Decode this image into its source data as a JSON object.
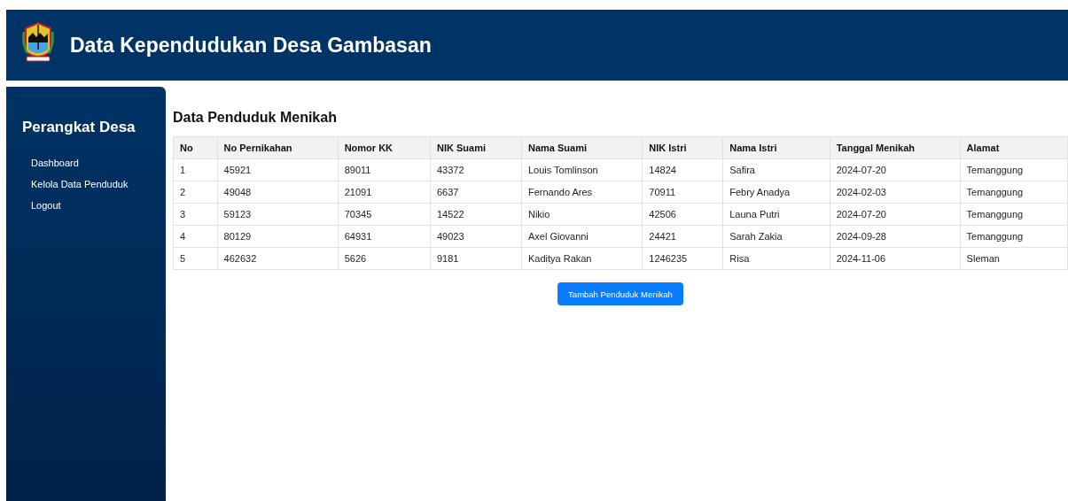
{
  "header": {
    "title": "Data Kependudukan Desa Gambasan"
  },
  "sidebar": {
    "title": "Perangkat Desa",
    "items": [
      {
        "label": "Dashboard"
      },
      {
        "label": "Kelola Data Penduduk"
      },
      {
        "label": "Logout"
      }
    ]
  },
  "main": {
    "title": "Data Penduduk Menikah",
    "table": {
      "columns": [
        "No",
        "No Pernikahan",
        "Nomor KK",
        "NIK Suami",
        "Nama Suami",
        "NIK Istri",
        "Nama Istri",
        "Tanggal Menikah",
        "Alamat"
      ],
      "rows": [
        [
          "1",
          "45921",
          "89011",
          "43372",
          "Louis Tomlinson",
          "14824",
          "Safira",
          "2024-07-20",
          "Temanggung"
        ],
        [
          "2",
          "49048",
          "21091",
          "6637",
          "Fernando Ares",
          "70911",
          "Febry Anadya",
          "2024-02-03",
          "Temanggung"
        ],
        [
          "3",
          "59123",
          "70345",
          "14522",
          "Nikio",
          "42506",
          "Launa Putri",
          "2024-07-20",
          "Temanggung"
        ],
        [
          "4",
          "80129",
          "64931",
          "49023",
          "Axel Giovanni",
          "24421",
          "Sarah Zakia",
          "2024-09-28",
          "Temanggung"
        ],
        [
          "5",
          "462632",
          "5626",
          "9181",
          "Kaditya Rakan",
          "1246235",
          "Risa",
          "2024-11-06",
          "Sleman"
        ]
      ]
    },
    "button": "Tambah Penduduk Menikah"
  }
}
